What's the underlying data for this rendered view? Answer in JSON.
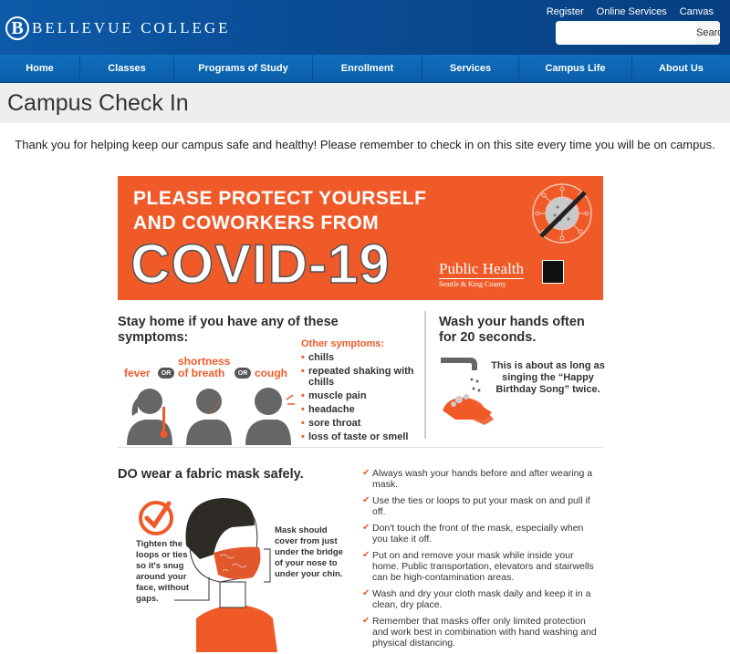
{
  "header": {
    "logo_letter": "B",
    "logo_text": "BELLEVUE COLLEGE",
    "top_links": [
      "Register",
      "Online Services",
      "Canvas"
    ],
    "search": {
      "placeholder": "",
      "value": "",
      "button_label": "Search"
    }
  },
  "nav": {
    "items": [
      "Home",
      "Classes",
      "Programs of Study",
      "Enrollment",
      "Services",
      "Campus Life",
      "About Us"
    ]
  },
  "page": {
    "title": "Campus Check In",
    "intro": "Thank you for helping keep our campus safe and healthy! Please remember to check in on this site every time you will be on campus."
  },
  "poster": {
    "colors": {
      "accent": "#f05a28",
      "dark": "#2d2d2d"
    },
    "banner_line1": "PLEASE PROTECT YOURSELF",
    "banner_line2": "AND COWORKERS FROM",
    "banner_covid": "COVID-19",
    "org_name": "Public Health",
    "org_sub": "Seattle & King County",
    "symptoms_title": "Stay home if you have any of these symptoms:",
    "symptoms": [
      "fever",
      "shortness of breath",
      "cough"
    ],
    "or_label": "OR",
    "other_title": "Other symptoms:",
    "other_symptoms": [
      "chills",
      "repeated shaking with chills",
      "muscle pain",
      "headache",
      "sore throat",
      "loss of taste or smell"
    ],
    "wash_title": "Wash your hands often for 20 seconds.",
    "wash_note": "This is about as long as singing the “Happy Birthday Song” twice.",
    "mask_title": "DO wear a fabric mask safely.",
    "mask_left_note": "Tighten the loops or ties so it's snug around your face, without gaps.",
    "mask_right_note": "Mask should cover from just under the bridge of your nose to under your chin.",
    "mask_tips": [
      "Always wash your hands before and after wearing a mask.",
      "Use the ties or loops to put your mask on and pull if off.",
      "Don't touch the front of the mask, especially when you take it off.",
      "Put on and remove your mask while inside your home. Public transportation, elevators and stairwells can be high-contamination areas.",
      "Wash and dry your cloth mask daily and keep it in a clean, dry place.",
      "Remember that masks offer only limited protection and work best in combination with hand washing and physical distancing."
    ]
  }
}
